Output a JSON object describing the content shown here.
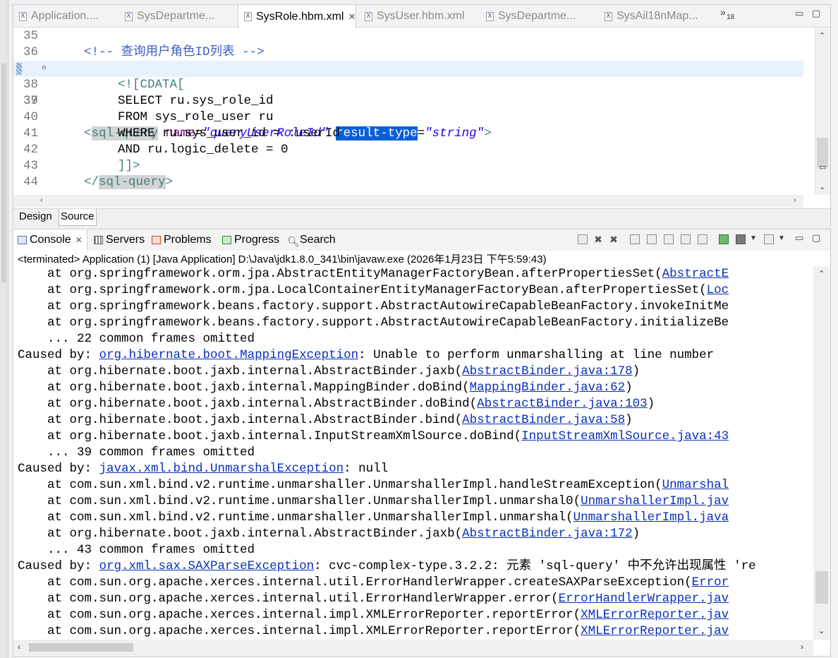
{
  "editor": {
    "tabs": [
      {
        "label": "Application....",
        "active": false
      },
      {
        "label": "SysDepartme...",
        "active": false
      },
      {
        "label": "SysRole.hbm.xml",
        "active": true
      },
      {
        "label": "SysUser.hbm.xml",
        "active": false
      },
      {
        "label": "SysDepartme...",
        "active": false
      },
      {
        "label": "SysAil18nMap...",
        "active": false
      }
    ],
    "overflow_count": "18",
    "lines": [
      {
        "num": "35"
      },
      {
        "num": "36",
        "comment": "<!-- 查询用户角色ID列表 -->"
      },
      {
        "num": "37",
        "open": "<",
        "tag": "sql-query",
        "attr1": "name",
        "eq1": "=",
        "val1": "\"queryUserRoleId\"",
        "attr2": "result-type",
        "eq2": "=",
        "val2": "\"string\"",
        "close": ">"
      },
      {
        "num": "38",
        "text": "<![CDATA["
      },
      {
        "num": "39",
        "text": "SELECT ru.sys_role_id"
      },
      {
        "num": "40",
        "text": "FROM sys_role_user ru"
      },
      {
        "num": "41",
        "text": "WHERE ru.sys_user_id = :userId"
      },
      {
        "num": "42",
        "text": "AND ru.logic_delete = 0"
      },
      {
        "num": "43",
        "text": "]]>"
      },
      {
        "num": "44",
        "open": "</",
        "tag": "sql-query",
        "close": ">"
      }
    ],
    "bottom_tabs": {
      "design": "Design",
      "source": "Source"
    }
  },
  "console": {
    "tabs": {
      "console": "Console",
      "servers": "Servers",
      "problems": "Problems",
      "progress": "Progress",
      "search": "Search"
    },
    "status": "<terminated> Application (1) [Java Application] D:\\Java\\jdk1.8.0_341\\bin\\javaw.exe  (2026年1月23日 下午5:59:43)",
    "log": [
      {
        "pre": "    at org.springframework.orm.jpa.AbstractEntityManagerFactoryBean.afterPropertiesSet(",
        "link": "AbstractE",
        "post": ""
      },
      {
        "pre": "    at org.springframework.orm.jpa.LocalContainerEntityManagerFactoryBean.afterPropertiesSet(",
        "link": "Loc",
        "post": ""
      },
      {
        "pre": "    at org.springframework.beans.factory.support.AbstractAutowireCapableBeanFactory.invokeInitMe",
        "link": "",
        "post": ""
      },
      {
        "pre": "    at org.springframework.beans.factory.support.AbstractAutowireCapableBeanFactory.initializeBe",
        "link": "",
        "post": ""
      },
      {
        "pre": "    ... 22 common frames omitted",
        "link": "",
        "post": ""
      },
      {
        "pre": "Caused by: ",
        "link": "org.hibernate.boot.MappingException",
        "post": ": Unable to perform unmarshalling at line number"
      },
      {
        "pre": "    at org.hibernate.boot.jaxb.internal.AbstractBinder.jaxb(",
        "link": "AbstractBinder.java:178",
        "post": ")"
      },
      {
        "pre": "    at org.hibernate.boot.jaxb.internal.MappingBinder.doBind(",
        "link": "MappingBinder.java:62",
        "post": ")"
      },
      {
        "pre": "    at org.hibernate.boot.jaxb.internal.AbstractBinder.doBind(",
        "link": "AbstractBinder.java:103",
        "post": ")"
      },
      {
        "pre": "    at org.hibernate.boot.jaxb.internal.AbstractBinder.bind(",
        "link": "AbstractBinder.java:58",
        "post": ")"
      },
      {
        "pre": "    at org.hibernate.boot.jaxb.internal.InputStreamXmlSource.doBind(",
        "link": "InputStreamXmlSource.java:43",
        "post": ""
      },
      {
        "pre": "    ... 39 common frames omitted",
        "link": "",
        "post": ""
      },
      {
        "pre": "Caused by: ",
        "link": "javax.xml.bind.UnmarshalException",
        "post": ": null"
      },
      {
        "pre": "    at com.sun.xml.bind.v2.runtime.unmarshaller.UnmarshallerImpl.handleStreamException(",
        "link": "Unmarshal",
        "post": ""
      },
      {
        "pre": "    at com.sun.xml.bind.v2.runtime.unmarshaller.UnmarshallerImpl.unmarshal0(",
        "link": "UnmarshallerImpl.jav",
        "post": ""
      },
      {
        "pre": "    at com.sun.xml.bind.v2.runtime.unmarshaller.UnmarshallerImpl.unmarshal(",
        "link": "UnmarshallerImpl.java",
        "post": ""
      },
      {
        "pre": "    at org.hibernate.boot.jaxb.internal.AbstractBinder.jaxb(",
        "link": "AbstractBinder.java:172",
        "post": ")"
      },
      {
        "pre": "    ... 43 common frames omitted",
        "link": "",
        "post": ""
      },
      {
        "pre": "Caused by: ",
        "link": "org.xml.sax.SAXParseException",
        "post": ": cvc-complex-type.3.2.2: 元素 'sql-query' 中不允许出现属性 're"
      },
      {
        "pre": "    at com.sun.org.apache.xerces.internal.util.ErrorHandlerWrapper.createSAXParseException(",
        "link": "Error",
        "post": ""
      },
      {
        "pre": "    at com.sun.org.apache.xerces.internal.util.ErrorHandlerWrapper.error(",
        "link": "ErrorHandlerWrapper.jav",
        "post": ""
      },
      {
        "pre": "    at com.sun.org.apache.xerces.internal.impl.XMLErrorReporter.reportError(",
        "link": "XMLErrorReporter.jav",
        "post": ""
      },
      {
        "pre": "    at com.sun.org.apache.xerces.internal.impl.XMLErrorReporter.reportError(",
        "link": "XMLErrorReporter.jav",
        "post": ""
      }
    ]
  }
}
